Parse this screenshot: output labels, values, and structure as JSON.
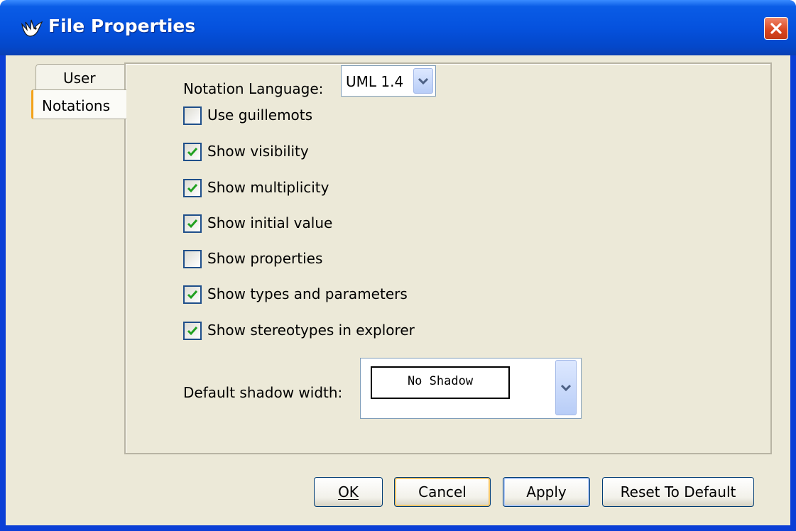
{
  "window": {
    "title": "File Properties"
  },
  "tabs": [
    {
      "label": "User",
      "selected": false
    },
    {
      "label": "Notations",
      "selected": true
    }
  ],
  "notation": {
    "label": "Notation Language:",
    "value": "UML 1.4"
  },
  "options": [
    {
      "label": "Use guillemots",
      "checked": false
    },
    {
      "label": "Show visibility",
      "checked": true
    },
    {
      "label": "Show multiplicity",
      "checked": true
    },
    {
      "label": "Show initial value",
      "checked": true
    },
    {
      "label": "Show properties",
      "checked": false
    },
    {
      "label": "Show types and parameters",
      "checked": true
    },
    {
      "label": "Show stereotypes in explorer",
      "checked": true
    }
  ],
  "shadow": {
    "label": "Default shadow width:",
    "value": "No Shadow"
  },
  "buttons": {
    "ok": "OK",
    "cancel": "Cancel",
    "apply": "Apply",
    "reset": "Reset To Default"
  },
  "colors": {
    "titlebar": "#0552de",
    "checkmark": "#21a121",
    "dialog_bg": "#ece9d8",
    "tab_accent": "#f3a21a"
  }
}
